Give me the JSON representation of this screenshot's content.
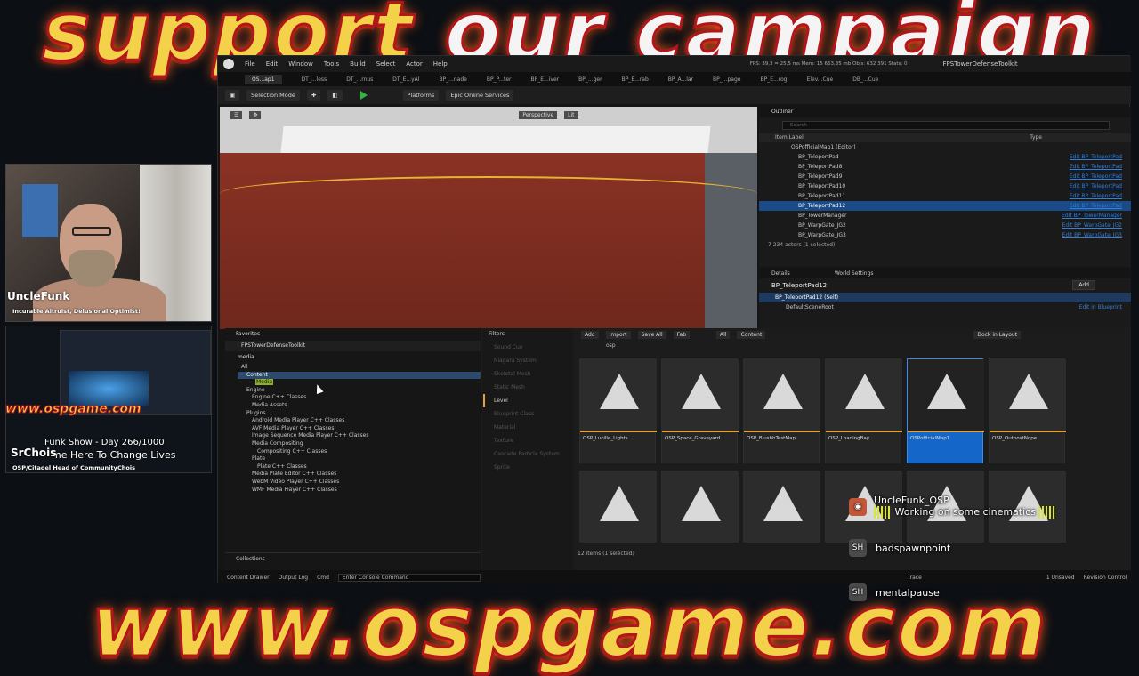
{
  "banner": {
    "top_a": "support ",
    "top_b": "our campaign",
    "bottom": "www.ospgame.com"
  },
  "menu": [
    "File",
    "Edit",
    "Window",
    "Tools",
    "Build",
    "Select",
    "Actor",
    "Help"
  ],
  "stats": "FPS: 39,3 = 25,5 ms  Mem: 15 663,35 mb  Objs: 632 391  Stats: 0",
  "project": "FPSTowerDefenseToolkit",
  "tabs": [
    "OS...ap1",
    "DT_...less",
    "DT_...rnus",
    "DT_E...yAl",
    "BP_...nade",
    "BP_P...ter",
    "BP_E...iver",
    "BP_...ger",
    "BP_E...rab",
    "BP_A...lar",
    "BP_...page",
    "BP_E...rog",
    "Elev...Cue",
    "DB_...Cue"
  ],
  "toolbar": {
    "mode": "Selection Mode",
    "platforms": "Platforms",
    "eos": "Epic Online Services"
  },
  "viewport": {
    "persp": "Perspective",
    "lit": "Lit"
  },
  "outliner": {
    "title": "Outliner",
    "search": "Search",
    "col_label": "Item Label",
    "col_type": "Type",
    "root": "OSPofficialMap1 (Editor)",
    "rows": [
      {
        "label": "BP_TeleportPad",
        "type": "Edit BP_TeleportPad"
      },
      {
        "label": "BP_TeleportPad8",
        "type": "Edit BP_TeleportPad"
      },
      {
        "label": "BP_TeleportPad9",
        "type": "Edit BP_TeleportPad"
      },
      {
        "label": "BP_TeleportPad10",
        "type": "Edit BP_TeleportPad"
      },
      {
        "label": "BP_TeleportPad11",
        "type": "Edit BP_TeleportPad"
      },
      {
        "label": "BP_TeleportPad12",
        "type": "Edit BP_TeleportPad"
      },
      {
        "label": "BP_TowerManager",
        "type": "Edit BP_TowerManager"
      },
      {
        "label": "BP_WarpGate_JG2",
        "type": "Edit BP_WarpGate_JG2"
      },
      {
        "label": "BP_WarpGate_JG3",
        "type": "Edit BP_WarpGate_JG3"
      }
    ],
    "footer": "7 234 actors (1 selected)"
  },
  "details": {
    "tab1": "Details",
    "tab2": "World Settings",
    "name": "BP_TeleportPad12",
    "add": "Add",
    "self": "BP_TeleportPad12 (Self)",
    "root": "DefaultSceneRoot",
    "edit_bp": "Edit in Blueprint"
  },
  "content": {
    "favorites": "Favorites",
    "root": "FPSTowerDefenseToolkit",
    "search": "media",
    "tree": [
      "All",
      "Content",
      "Media",
      "Engine",
      "Engine C++ Classes",
      "Media Assets",
      "Plugins",
      "Android Media Player C++ Classes",
      "AVF Media Player C++ Classes",
      "Image Sequence Media Player C++ Classes",
      "Media Compositing",
      "Compositing C++ Classes",
      "Plate",
      "Plate C++ Classes",
      "Media Plate Editor C++ Classes",
      "WebM Video Player C++ Classes",
      "WMF Media Player C++ Classes"
    ],
    "collections": "Collections",
    "filters_title": "Filters",
    "filters": [
      "Sound Cue",
      "Niagara System",
      "Skeletal Mesh",
      "Static Mesh",
      "Level",
      "Blueprint Class",
      "Material",
      "Texture",
      "Cascade Particle System",
      "Sprite"
    ],
    "add": "Add",
    "import": "Import",
    "save_all": "Save All",
    "fab": "Fab",
    "path_all": "All",
    "path_content": "Content",
    "filter_tag": "osp",
    "dock": "Dock in Layout",
    "tiles": [
      "OSP_Lucille_Lights",
      "OSP_Space_Graveyard",
      "OSP_BlushhTestMap",
      "OSP_LoadingBay",
      "OSPofficialMap1",
      "OSP_OutpostNope"
    ],
    "count": "12 items (1 selected)"
  },
  "status": {
    "drawer": "Content Drawer",
    "log": "Output Log",
    "cmd": "Cmd",
    "input": "Enter Console Command",
    "trace": "Trace",
    "unsaved": "1 Unsaved",
    "revision": "Revision Control"
  },
  "cam1": {
    "name": "UncleFunk",
    "subtitle": "Incurable Altruist, Delusional Optimist!"
  },
  "cam2": {
    "url": "www.ospgame.com",
    "ticker1": "Funk Show - Day 266/1000",
    "ticker2": "me Here To Change Lives",
    "name": "SrChois",
    "subtitle": "OSP/Citadel Head of Community",
    "subtitle_b": "Chois"
  },
  "chat": [
    {
      "user": "UncleFunk_OSP",
      "msg": "Working on some cinematics"
    },
    {
      "user": "badspawnpoint",
      "msg": ""
    },
    {
      "user": "mentalpause",
      "msg": ""
    }
  ]
}
